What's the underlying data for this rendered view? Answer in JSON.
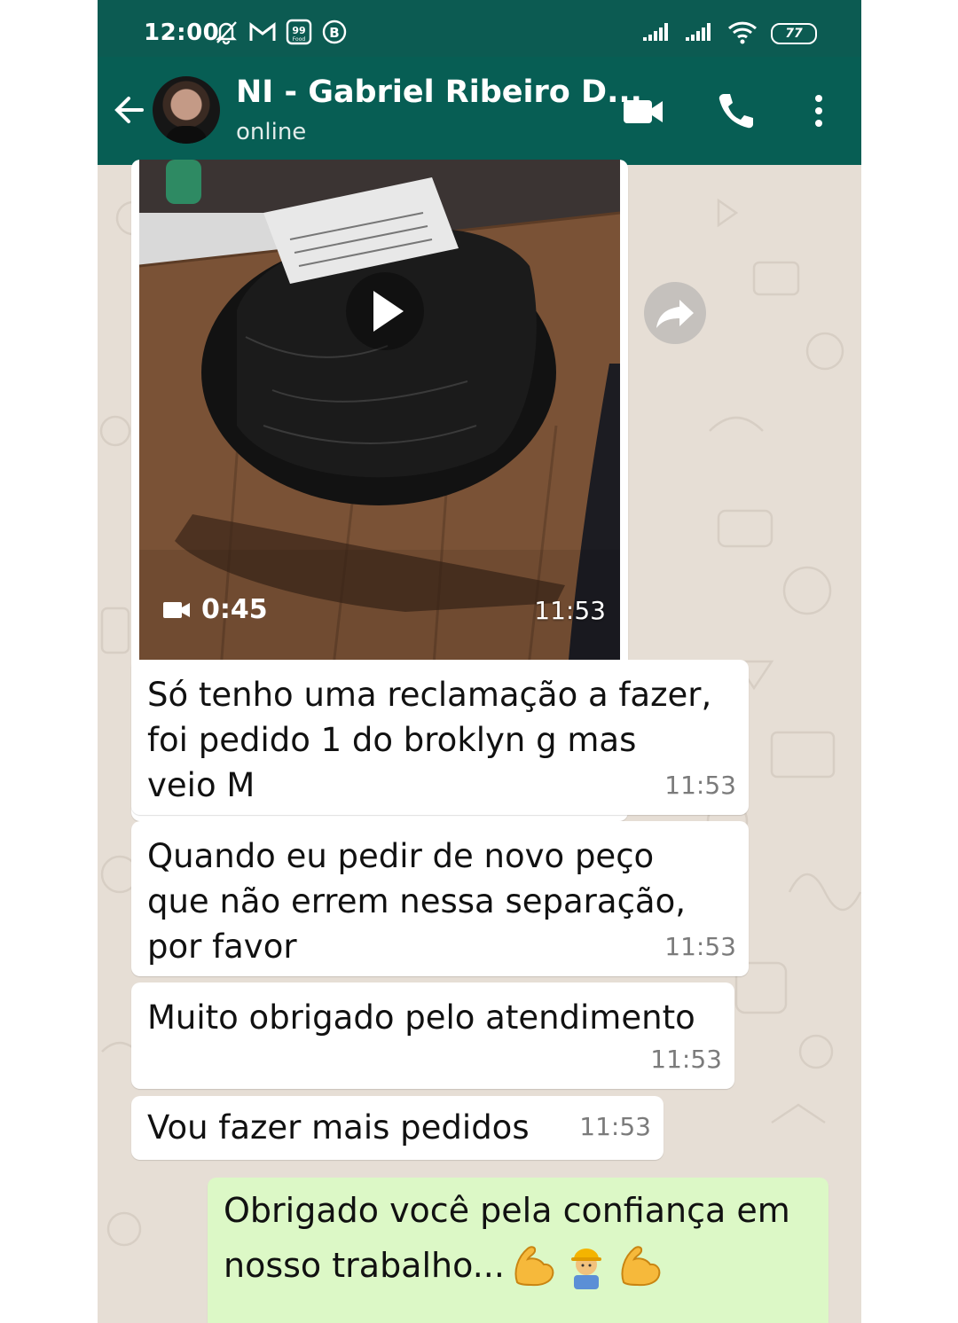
{
  "status_bar": {
    "time": "12:00",
    "battery": "77",
    "left_icons": [
      "muted-bell-icon",
      "gmail-icon",
      "99food-icon",
      "b-badge-icon"
    ],
    "right_icons": [
      "signal-icon",
      "signal-icon",
      "wifi-icon",
      "battery-icon"
    ]
  },
  "header": {
    "contact_name": "NI - Gabriel Ribeiro D...",
    "status": "online",
    "colors": {
      "bar": "#075e54",
      "status_bar": "#0c5b52"
    }
  },
  "video_message": {
    "duration": "0:45",
    "time": "11:53"
  },
  "messages": [
    {
      "direction": "in",
      "text": "Só tenho uma reclamação a fazer,\nfoi pedido 1 do broklyn g mas\nveio M",
      "time": "11:53"
    },
    {
      "direction": "in",
      "text": "Quando eu pedir de novo peço\nque não errem nessa separação,\npor favor",
      "time": "11:53"
    },
    {
      "direction": "in",
      "text": "Muito obrigado pelo atendimento",
      "time": "11:53"
    },
    {
      "direction": "in",
      "text": "Vou fazer mais pedidos",
      "time": "11:53"
    },
    {
      "direction": "out",
      "text": "Obrigado você pela confiança em\nnosso trabalho...",
      "emojis": [
        "flexed-biceps-icon",
        "construction-worker-icon",
        "flexed-biceps-icon"
      ]
    }
  ],
  "colors": {
    "incoming_bubble": "#ffffff",
    "outgoing_bubble": "#dcf8c6",
    "wallpaper": "#e6ded5"
  }
}
